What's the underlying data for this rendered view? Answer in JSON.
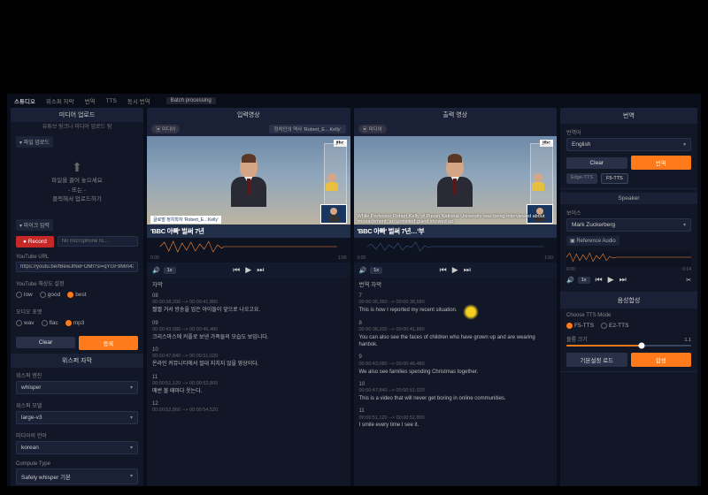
{
  "tabs": {
    "studio": "스튜디오",
    "whisper": "위스퍼 자막",
    "translate": "번역",
    "tts": "TTS",
    "sync": "동시 번역",
    "batch": "Batch processing"
  },
  "left": {
    "upload_title": "미디어 업로드",
    "upload_sub": "유튜브 링크나 미디어 업로드 됨",
    "file_upload_label": "파일 업로드",
    "drop_line1": "파일을 끌어 놓으세요",
    "drop_line2": "- 또는 -",
    "drop_line3": "클릭해서 업로드하기",
    "mic_label": "마이크 입력",
    "record": "Record",
    "no_mic": "No microphone fo...",
    "yt_url_label": "YouTube URL",
    "yt_url": "https://youtu.be/fBewJlNeFOMI?si=qYGF9Mm430IBIJE0G",
    "yt_quality_label": "YouTube 해상도 설정",
    "q_low": "low",
    "q_good": "good",
    "q_best": "best",
    "audio_fmt_label": "오디오 포멧",
    "f_wav": "wav",
    "f_flac": "flac",
    "f_mp3": "mp3",
    "clear": "Clear",
    "submit": "등록",
    "whisper_title": "위스퍼 자막",
    "engine_label": "위스퍼 엔진",
    "engine": "whisper",
    "model_label": "위스퍼 모델",
    "model": "large-v3",
    "lang_label": "미디어의 언어",
    "lang": "korean",
    "compute_label": "Compute Type",
    "compute": "Safely whisper 기본"
  },
  "mid1": {
    "title": "입력영상",
    "pill": "미디어",
    "filename": "정치인의 역사 'Robert_E…Kelly'",
    "chyron_tag": "글로벌 정치학자 'Robert_E…Kelly'",
    "chyron": "'BBC 아빠' 벌써 7년",
    "brand": "jtbc",
    "wave_start": "0:00",
    "wave_end": "1:00",
    "speed": "1x",
    "subtitle_header": "자막",
    "entries": [
      {
        "n": "08",
        "ts": "00:00:38,200 --> 00:00:41,880",
        "txt": "쩔쩔 거서 방송을 업은 아이들이 앞으로 나오고요."
      },
      {
        "n": "09",
        "ts": "00:00:43,080 --> 00:00:46,480",
        "txt": "크리스마스에 커플로 보낸 가족들의 모습도 보입니다."
      },
      {
        "n": "10",
        "ts": "00:00:47,840 --> 00:00:51,020",
        "txt": "온라인 커뮤니티에서 절대 지치지 않을 영상이다."
      },
      {
        "n": "11",
        "ts": "00:00:51,120 --> 00:00:52,800",
        "txt": "매번 볼 때마다 웃는다."
      },
      {
        "n": "12",
        "ts": "00:00:52,860 --> 00:00:54,520",
        "txt": ""
      }
    ]
  },
  "mid2": {
    "title": "출력 영상",
    "pill": "미디어",
    "chyron": "'BBC 아빠' 벌써 7년…'부",
    "overlay": "While Professor Robert Kelly of Pusan National University was being interviewed about impeachment, an uninvited guest showed up.",
    "wave_start": "0:00",
    "wave_end": "1:00",
    "speed": "1x",
    "subtitle_header": "번역 자막",
    "entries": [
      {
        "n": "7",
        "ts": "00:00:35,360 --> 00:00:38,580",
        "txt": "This is how I reported my recent situation."
      },
      {
        "n": "8",
        "ts": "00:00:38,200 --> 00:00:41,880",
        "txt": "You can also see the faces of children who have grown up and are wearing hanbok."
      },
      {
        "n": "9",
        "ts": "00:00:43,080 --> 00:00:46,480",
        "txt": "We also see families spending Christmas together."
      },
      {
        "n": "10",
        "ts": "00:00:47,840 --> 00:00:51,020",
        "txt": "This is a video that will never get boring in online communities."
      },
      {
        "n": "11",
        "ts": "00:00:51,120 --> 00:00:52,800",
        "txt": "I smile every time I see it."
      }
    ]
  },
  "right": {
    "trans_title": "번역",
    "lang_label": "번역어",
    "lang": "English",
    "clear": "Clear",
    "translate": "번역",
    "edge_tts": "Edge-TTS",
    "f5_tts": "F5-TTS",
    "speaker": "Speaker",
    "voice_label": "보이스",
    "voice": "Mark Zuckerberg",
    "ref_audio": "Reference Audio",
    "ref_start": "0:00",
    "ref_end": "0:14",
    "ref_speed": "1x",
    "synth_title": "음성합성",
    "tts_mode_label": "Choose TTS Mode",
    "mode_f5": "F5-TTS",
    "mode_e2": "E2-TTS",
    "vol_label": "볼륨 크기",
    "vol": "1.1",
    "load": "기본설정 로드",
    "synth": "합성"
  }
}
